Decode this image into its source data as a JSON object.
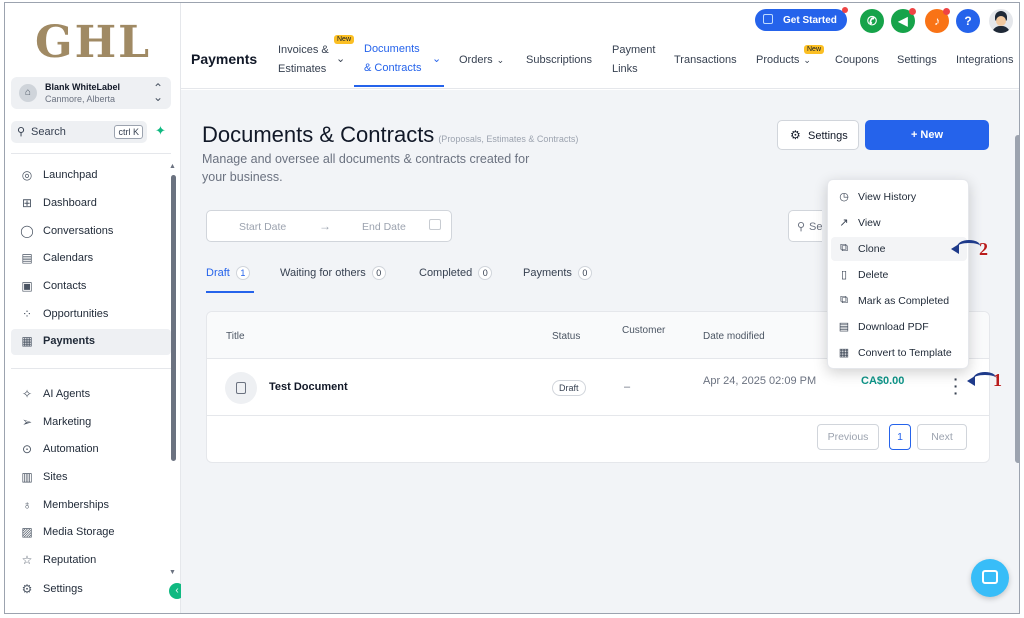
{
  "brand": {
    "logo_text": "GHL"
  },
  "account": {
    "name": "Blank WhiteLabel",
    "location": "Canmore, Alberta"
  },
  "search": {
    "label": "Search",
    "shortcut": "ctrl K"
  },
  "sidebar": {
    "items": [
      {
        "label": "Launchpad",
        "icon": "rocket-icon"
      },
      {
        "label": "Dashboard",
        "icon": "grid-icon"
      },
      {
        "label": "Conversations",
        "icon": "chat-icon"
      },
      {
        "label": "Calendars",
        "icon": "calendar-icon"
      },
      {
        "label": "Contacts",
        "icon": "contacts-icon"
      },
      {
        "label": "Opportunities",
        "icon": "funnel-icon"
      },
      {
        "label": "Payments",
        "icon": "receipt-icon",
        "active": true
      },
      {
        "label": "AI Agents",
        "icon": "sparkle-icon"
      },
      {
        "label": "Marketing",
        "icon": "send-icon"
      },
      {
        "label": "Automation",
        "icon": "automation-icon"
      },
      {
        "label": "Sites",
        "icon": "sites-icon"
      },
      {
        "label": "Memberships",
        "icon": "membership-icon"
      },
      {
        "label": "Media Storage",
        "icon": "image-icon"
      },
      {
        "label": "Reputation",
        "icon": "star-icon"
      },
      {
        "label": "Settings",
        "icon": "gear-icon"
      }
    ]
  },
  "topnav": {
    "section_title": "Payments",
    "items": [
      {
        "line1": "Invoices &",
        "line2": "Estimates"
      },
      {
        "line1": "Documents",
        "line2": "& Contracts"
      },
      {
        "label": "Orders"
      },
      {
        "label": "Subscriptions"
      },
      {
        "line1": "Payment",
        "line2": "Links"
      },
      {
        "label": "Transactions"
      },
      {
        "label": "Products"
      },
      {
        "label": "Coupons"
      },
      {
        "label": "Settings"
      },
      {
        "label": "Integrations"
      }
    ],
    "new_badge": "New",
    "get_started": "Get Started",
    "help_glyph": "?"
  },
  "page": {
    "title": "Documents & Contracts",
    "subtitle": "(Proposals, Estimates & Contracts)",
    "description": "Manage and oversee all documents & contracts created for your business.",
    "settings_button": "Settings",
    "new_button": "+ New",
    "start_date_placeholder": "Start Date",
    "end_date_placeholder": "End Date",
    "search_placeholder": "Search"
  },
  "tabs": [
    {
      "label": "Draft",
      "count": "1",
      "active": true
    },
    {
      "label": "Waiting for others",
      "count": "0"
    },
    {
      "label": "Completed",
      "count": "0"
    },
    {
      "label": "Payments",
      "count": "0"
    }
  ],
  "table": {
    "headers": {
      "title": "Title",
      "status": "Status",
      "customer": "Customer",
      "date": "Date modified"
    },
    "rows": [
      {
        "title": "Test Document",
        "status": "Draft",
        "customer": "–",
        "date": "Apr 24, 2025 02:09 PM",
        "amount": "CA$0.00"
      }
    ],
    "pagination": {
      "previous": "Previous",
      "page": "1",
      "next": "Next"
    }
  },
  "menu": {
    "items": [
      {
        "label": "View History",
        "icon": "history-icon"
      },
      {
        "label": "View",
        "icon": "arrow-up-right-icon"
      },
      {
        "label": "Clone",
        "icon": "copy-icon",
        "highlighted": true
      },
      {
        "label": "Delete",
        "icon": "trash-icon"
      },
      {
        "label": "Mark as Completed",
        "icon": "check-copy-icon"
      },
      {
        "label": "Download PDF",
        "icon": "pdf-icon"
      },
      {
        "label": "Convert to Template",
        "icon": "template-icon"
      }
    ]
  },
  "annotations": [
    {
      "number": "1"
    },
    {
      "number": "2"
    }
  ],
  "colors": {
    "accent": "#2563eb",
    "brand_gold": "#a08a64",
    "success": "#10b981",
    "amount": "#0d9488",
    "annotation_arrow": "#1e3a8a",
    "annotation_number": "#b91c1c"
  }
}
